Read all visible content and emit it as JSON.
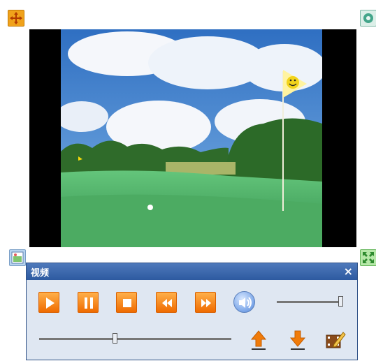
{
  "panel": {
    "title": "视频",
    "close_label": "×"
  },
  "playback": {
    "volume_level": 1.0,
    "progress_fraction": 0.39
  },
  "icons": {
    "move_handle": "move-icon",
    "settings_handle": "settings-icon",
    "snapshot_handle": "image-icon",
    "fullscreen_handle": "fullscreen-icon",
    "play": "play-icon",
    "pause": "pause-icon",
    "stop": "stop-icon",
    "rewind": "rewind-icon",
    "forward": "fast-forward-icon",
    "volume": "volume-icon",
    "upload": "upload-icon",
    "download": "download-icon",
    "edit": "video-edit-icon"
  },
  "colors": {
    "accent": "#ef6b00",
    "panel_title_bg": "#2d5aa0",
    "panel_bg": "#dfe7f2"
  }
}
